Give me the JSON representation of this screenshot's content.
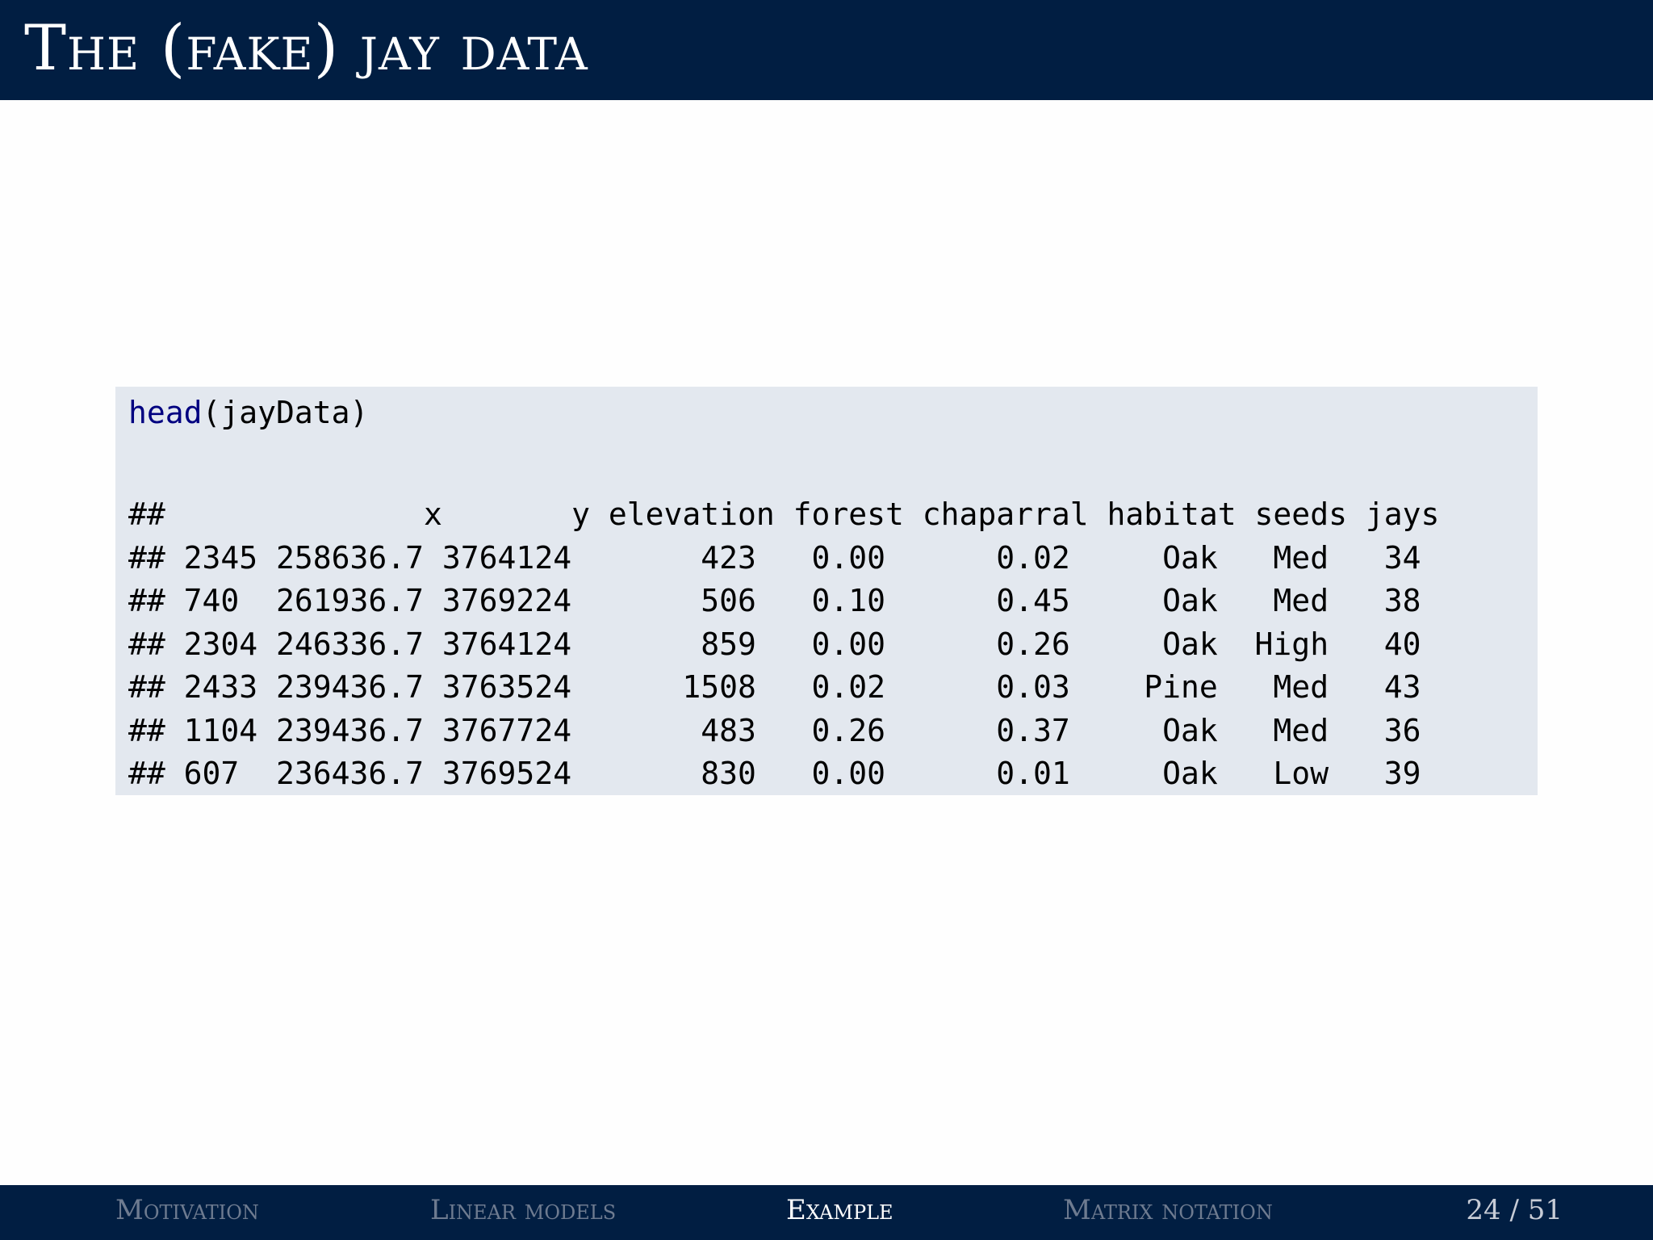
{
  "slide": {
    "title": "The (fake) jay data"
  },
  "code": {
    "function": "head",
    "args": "(jayData)",
    "output_lines": [
      "##              x       y elevation forest chaparral habitat seeds jays",
      "## 2345 258636.7 3764124       423   0.00      0.02     Oak   Med   34",
      "## 740  261936.7 3769224       506   0.10      0.45     Oak   Med   38",
      "## 2304 246336.7 3764124       859   0.00      0.26     Oak  High   40",
      "## 2433 239436.7 3763524      1508   0.02      0.03    Pine   Med   43",
      "## 1104 239436.7 3767724       483   0.26      0.37     Oak   Med   36",
      "## 607  236436.7 3769524       830   0.00      0.01     Oak   Low   39"
    ]
  },
  "footer": {
    "sections": [
      {
        "label": "Motivation"
      },
      {
        "label": "Linear models"
      },
      {
        "label": "Example"
      },
      {
        "label": "Matrix notation"
      }
    ],
    "page": "24 / 51"
  },
  "colors": {
    "title_bar": "#011e42",
    "code_background": "#e3e8ef",
    "function_name": "#000080",
    "footer_inactive": "#6e7b90",
    "footer_active": "#ffffff"
  }
}
